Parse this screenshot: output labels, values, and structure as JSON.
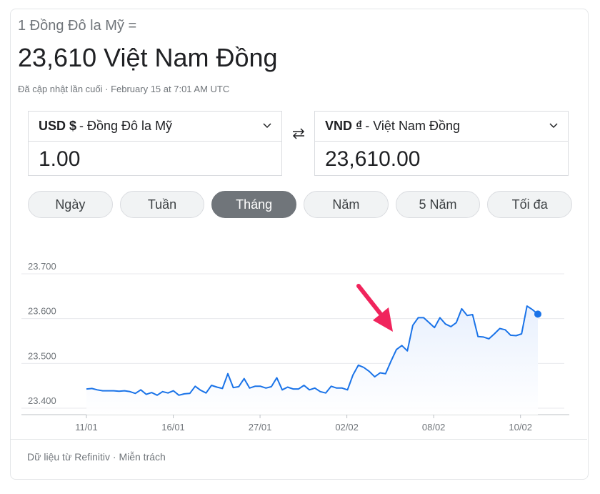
{
  "header": {
    "from_line": "1 Đồng Đô la Mỹ =",
    "to_value": "23,610 Việt Nam Đồng",
    "updated": "Đã cập nhật lần cuối · February 15 at 7:01 AM UTC"
  },
  "converter": {
    "from": {
      "code": "USD $",
      "name": "- Đồng Đô la Mỹ",
      "value": "1.00"
    },
    "to": {
      "code": "VND ₫",
      "name": "- Việt Nam Đồng",
      "value": "23,610.00"
    },
    "swap_icon": "swap-arrows-icon"
  },
  "ranges": [
    {
      "label": "Ngày",
      "active": false
    },
    {
      "label": "Tuần",
      "active": false
    },
    {
      "label": "Tháng",
      "active": true
    },
    {
      "label": "Năm",
      "active": false
    },
    {
      "label": "5 Năm",
      "active": false
    },
    {
      "label": "Tối đa",
      "active": false
    }
  ],
  "chart_data": {
    "type": "area",
    "y_ticks": [
      "23.700",
      "23.600",
      "23.500",
      "23.400"
    ],
    "y_tick_values": [
      23700,
      23600,
      23500,
      23400
    ],
    "ylim": [
      23370,
      23720
    ],
    "x_ticks": [
      {
        "label": "11/01",
        "index": 0
      },
      {
        "label": "16/01",
        "index": 10
      },
      {
        "label": "27/01",
        "index": 20
      },
      {
        "label": "02/02",
        "index": 30
      },
      {
        "label": "08/02",
        "index": 40
      },
      {
        "label": "10/02",
        "index": 50
      }
    ],
    "values": [
      23443,
      23444,
      23441,
      23439,
      23439,
      23439,
      23438,
      23439,
      23437,
      23433,
      23441,
      23431,
      23435,
      23429,
      23437,
      23434,
      23439,
      23429,
      23432,
      23433,
      23449,
      23440,
      23434,
      23451,
      23447,
      23444,
      23477,
      23446,
      23448,
      23466,
      23445,
      23449,
      23449,
      23445,
      23448,
      23468,
      23441,
      23447,
      23443,
      23443,
      23451,
      23441,
      23445,
      23437,
      23434,
      23449,
      23445,
      23445,
      23441,
      23474,
      23496,
      23491,
      23482,
      23470,
      23479,
      23477,
      23505,
      23531,
      23540,
      23528,
      23585,
      23602,
      23602,
      23591,
      23580,
      23602,
      23588,
      23582,
      23591,
      23622,
      23607,
      23609,
      23560,
      23559,
      23555,
      23566,
      23578,
      23575,
      23563,
      23562,
      23566,
      23628,
      23620,
      23610
    ],
    "line_color": "#1a73e8",
    "fill_color": "#e8f0fe",
    "grid": true
  },
  "annotation": {
    "arrow_color": "#f0245c"
  },
  "footer": {
    "text": "Dữ liệu từ Refinitiv · Miễn trách"
  }
}
